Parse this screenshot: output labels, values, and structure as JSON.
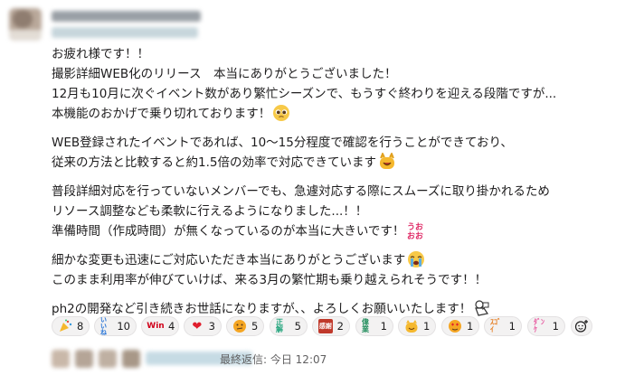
{
  "message": {
    "paragraphs": [
      [
        "お疲れ様です！！",
        "撮影詳細WEB化のリリース　本当にありがとうございました！",
        "12月も10月に次ぐイベント数があり繁忙シーズンで、もうすぐ終わりを迎える段階ですが...",
        "本機能のおかげで乗り切れております！"
      ],
      [
        "WEB登録されたイベントであれば、10〜15分程度で確認を行うことができており、",
        "従来の方法と比較すると約1.5倍の効率で対応できています"
      ],
      [
        "普段詳細対応を行っていないメンバーでも、急遽対応する際にスムーズに取り掛かれるため",
        "リソース調整なども柔軟に行えるようになりました...！！",
        "準備時間（作成時間）が無くなっているのが本当に大きいです！"
      ],
      [
        "細かな変更も迅速にご対応いただき本当にありがとうございます",
        "このまま利用率が伸びていけば、来る3月の繁忙期も乗り越えられそうです！！"
      ],
      [
        "ph2の開発など引き続きお世話になりますが、、よろしくお願いいたします！"
      ]
    ]
  },
  "reactions": [
    {
      "icon": "party-popper-icon",
      "count": "8"
    },
    {
      "icon": "iine-stamp-icon",
      "count": "10",
      "label": "いいね"
    },
    {
      "icon": "win-stamp-icon",
      "count": "4",
      "label": "Win"
    },
    {
      "icon": "red-heart-icon",
      "count": "3"
    },
    {
      "icon": "thinking-face-icon",
      "count": "5"
    },
    {
      "icon": "kanji-stamp-icon",
      "count": "5",
      "label": "正解"
    },
    {
      "icon": "red-stamp-icon",
      "count": "2",
      "label": "感謝"
    },
    {
      "icon": "gorin-stamp-icon",
      "count": "1",
      "label": "偉業"
    },
    {
      "icon": "cat-face-icon",
      "count": "1"
    },
    {
      "icon": "heart-face-icon",
      "count": "1"
    },
    {
      "icon": "orange-stamp-icon",
      "count": "1",
      "label": "ｽｺﾞｲ"
    },
    {
      "icon": "pink-stamp-icon",
      "count": "1",
      "label": "ﾀﾞﾝｹ"
    }
  ],
  "thread": {
    "last_reply": "最終返信: 今日 12:07"
  },
  "colors": {
    "chip_bg": "#f3f2f2",
    "chip_border": "#e3e1e2",
    "text": "#1d1c1d",
    "muted": "#616061"
  }
}
